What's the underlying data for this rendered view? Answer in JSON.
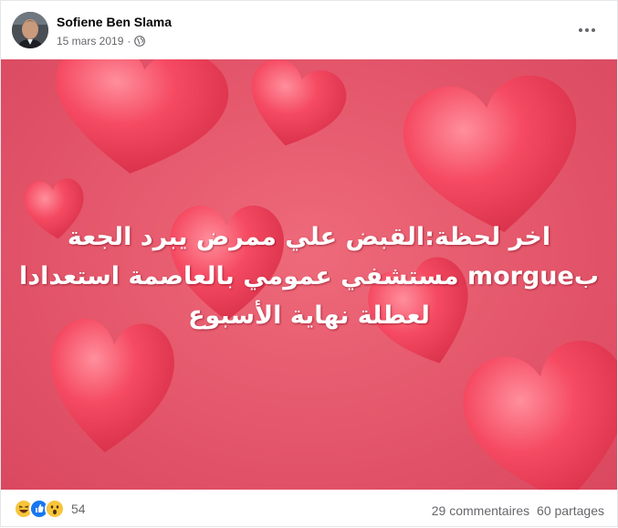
{
  "post": {
    "author": "Sofiene Ben Slama",
    "date": "15 mars 2019",
    "separator": "·",
    "privacy_icon": "globe-icon",
    "more_icon": "ellipsis-icon"
  },
  "image": {
    "caption_lines": [
      "اخر لحظة:القبض علي ممرض يبرد الجعة",
      "بmorgue مستشفي عمومي بالعاصمة استعدادا",
      "لعطلة نهاية الأسبوع"
    ],
    "background_color": "#e4566b",
    "heart_color": "#f0485e"
  },
  "footer": {
    "reaction_icons": [
      "haha-icon",
      "like-icon",
      "wow-icon"
    ],
    "reactions_count": "54",
    "comments": "29 commentaires",
    "shares": "60 partages"
  }
}
